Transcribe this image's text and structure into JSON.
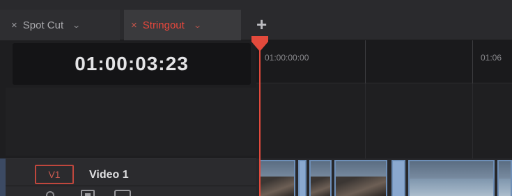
{
  "tabs": [
    {
      "label": "Spot Cut",
      "close": "×",
      "chevron": "⌄"
    },
    {
      "label": "Stringout",
      "close": "×",
      "chevron": "⌄"
    }
  ],
  "add_tab": "+",
  "timecode": "01:00:03:23",
  "ruler": {
    "labels": [
      "01:00:00:00",
      "01:06"
    ]
  },
  "track": {
    "id": "V1",
    "name": "Video 1"
  },
  "colors": {
    "accent": "#e34a3c",
    "clip_border": "#6e8fb8"
  },
  "icons": [
    "close-icon",
    "chevron-down-icon",
    "plus-icon",
    "lock-icon",
    "auto-select-icon",
    "track-visibility-icon",
    "playhead-icon"
  ]
}
